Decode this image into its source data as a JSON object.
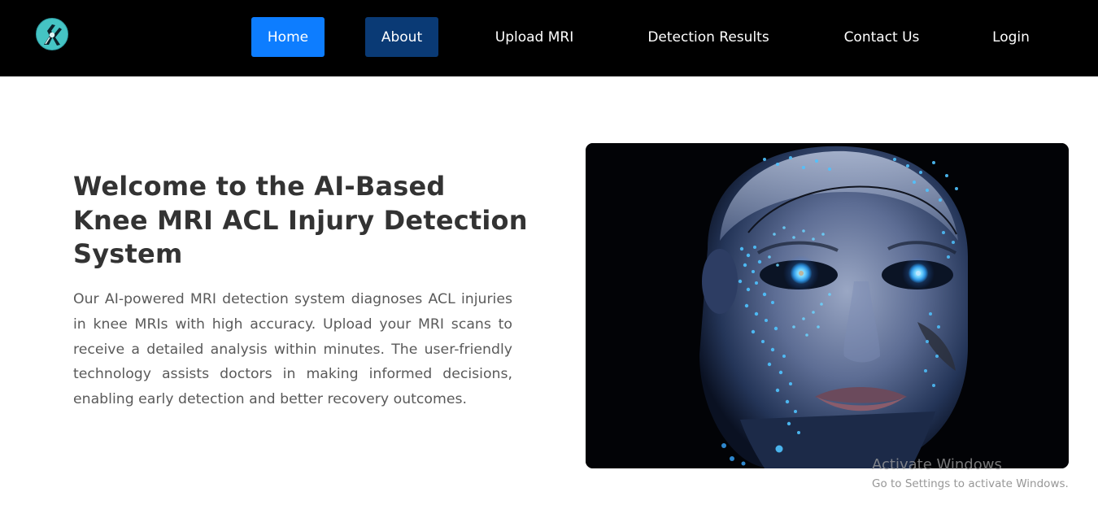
{
  "nav": {
    "items": [
      {
        "label": "Home",
        "style": "active"
      },
      {
        "label": "About",
        "style": "highlight"
      },
      {
        "label": "Upload MRI",
        "style": "plain"
      },
      {
        "label": "Detection Results",
        "style": "plain"
      },
      {
        "label": "Contact Us",
        "style": "plain"
      },
      {
        "label": "Login",
        "style": "plain"
      }
    ]
  },
  "hero": {
    "title": "Welcome to the AI-Based Knee MRI ACL Injury Detection System",
    "description": "Our AI-powered MRI detection system diagnoses ACL injuries in knee MRIs with high accuracy. Upload your MRI scans to receive a detailed analysis within minutes. The user-friendly technology assists doctors in making informed decisions, enabling early detection and better recovery outcomes.",
    "image_icon": "ai-face-illustration"
  },
  "watermark": {
    "title": "Activate Windows",
    "subtitle": "Go to Settings to activate Windows."
  },
  "colors": {
    "navbar_bg": "#000000",
    "nav_active_bg": "#0d7dff",
    "nav_highlight_bg": "#0a3a75",
    "nav_text": "#ffffff",
    "title_text": "#333333",
    "body_text": "#5a5a5a",
    "logo_teal": "#45c4c4"
  }
}
